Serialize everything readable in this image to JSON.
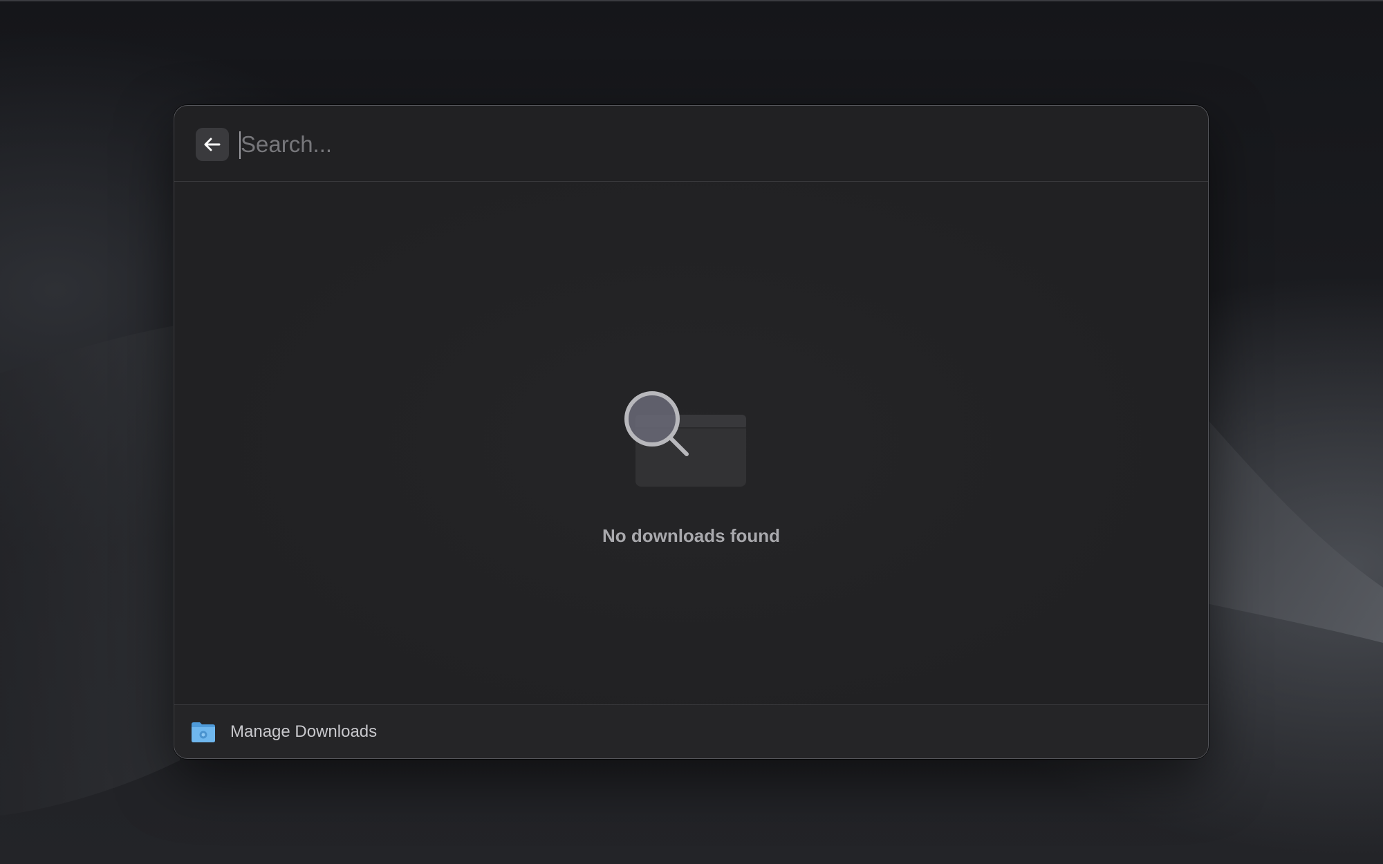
{
  "search": {
    "placeholder": "Search...",
    "value": ""
  },
  "back_button": {
    "icon": "arrow-left-icon"
  },
  "empty_state": {
    "icon": "search-folder-icon",
    "message": "No downloads found"
  },
  "footer": {
    "action_label": "Manage Downloads",
    "action_icon": "downloads-folder-icon"
  },
  "colors": {
    "window_bg": "#212123",
    "accent_folder": "#5aa8e6",
    "text_muted": "#a9a9ad"
  }
}
